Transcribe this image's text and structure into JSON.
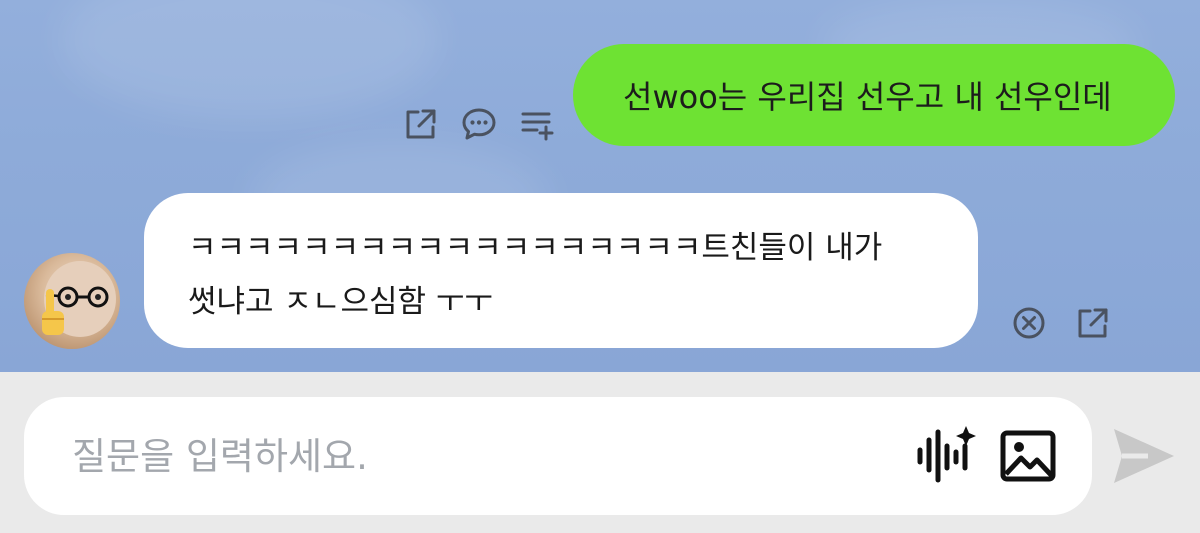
{
  "chat": {
    "outgoing": {
      "text": "선woo는 우리집 선우고 내 선우인데",
      "actions": [
        "share-icon",
        "comment-icon",
        "add-to-list-icon"
      ]
    },
    "incoming": {
      "line1": "ㅋㅋㅋㅋㅋㅋㅋㅋㅋㅋㅋㅋㅋㅋㅋㅋㅋㅋ트친들이 내가",
      "line2": "썻냐고 ㅈㄴ으심함 ㅜㅜ",
      "actions": [
        "close-circle-icon",
        "share-icon"
      ]
    }
  },
  "composer": {
    "placeholder": "질문을 입력하세요.",
    "icons": [
      "voice-sparkle-icon",
      "image-icon",
      "send-icon"
    ]
  },
  "colors": {
    "chat_background": "#8eabd9",
    "outgoing_bubble": "#6ee233",
    "incoming_bubble": "#ffffff",
    "composer_background": "#eaeaea",
    "icon_gray": "#4a5260",
    "send_disabled": "#c8c8c8"
  }
}
